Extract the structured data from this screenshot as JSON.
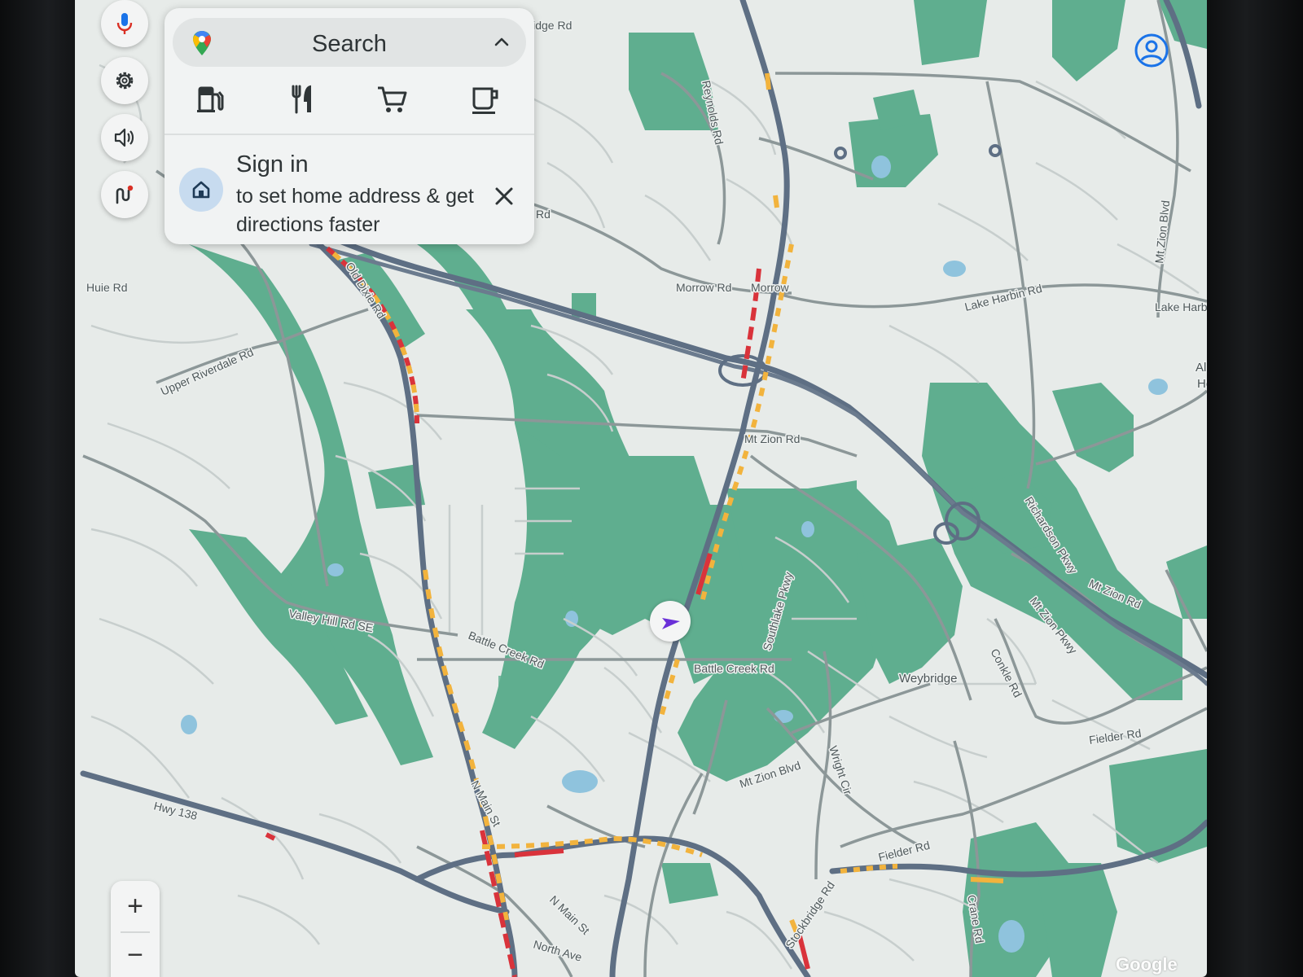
{
  "search": {
    "label": "Search"
  },
  "categories": [
    {
      "name": "gas-station-icon"
    },
    {
      "name": "restaurant-icon"
    },
    {
      "name": "grocery-icon"
    },
    {
      "name": "coffee-icon"
    }
  ],
  "signin": {
    "title": "Sign in",
    "subtitle": "to set home address & get directions faster"
  },
  "zoom": {
    "in_label": "+",
    "out_label": "−"
  },
  "attribution": "Google",
  "colors": {
    "park": "#5fae8f",
    "highway": "#5e6f84",
    "traffic_slow": "#f2b33d",
    "traffic_heavy": "#d9333b",
    "land": "#e7ebe9",
    "accent": "#1a73e8",
    "puck": "#6a30d8"
  },
  "map": {
    "roads": [
      "Ridge Rd",
      "Reynolds Rd",
      "Huie Rd",
      "Old Dixie Rd",
      "Upper Riverdale Rd",
      "Morrow Rd",
      "Morrow",
      "Lake Harbin Rd",
      "Mt Zion Blvd",
      "Lake Harb",
      "Alle",
      "He",
      "Mt Zion Rd",
      "Richardson Pkwy",
      "Mt Zion Rd",
      "Mt Zion Pkwy",
      "Valley Hill Rd SE",
      "Battle Creek Rd",
      "Southlake Pkwy",
      "Battle Creek Rd",
      "Weybridge",
      "Conkle Rd",
      "Fielder Rd",
      "Mt Zion Blvd",
      "Wright Cir",
      "Hwy 138",
      "N Main St",
      "N Main St",
      "North Ave",
      "Stockbridge Rd",
      "Fielder Rd",
      "Crane Rd",
      "Rd"
    ]
  }
}
